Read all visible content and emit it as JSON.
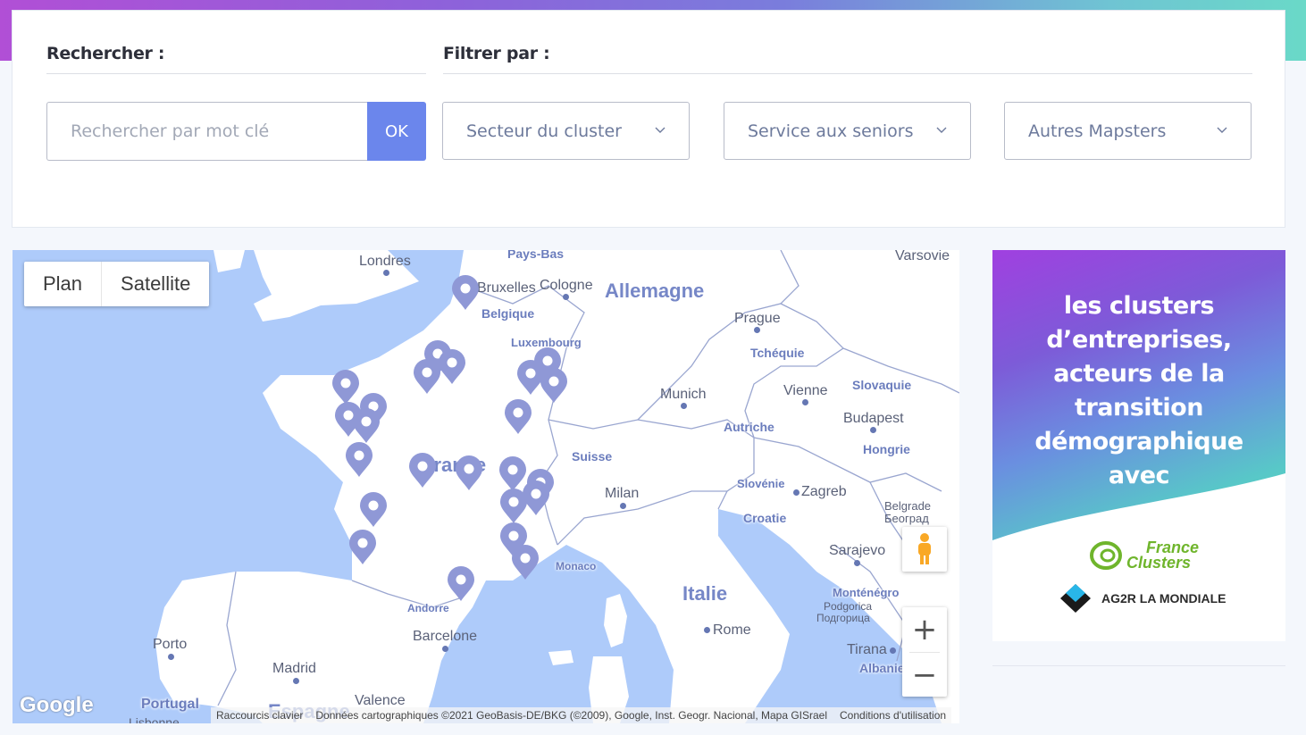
{
  "search": {
    "title": "Rechercher :",
    "placeholder": "Rechercher par mot clé",
    "ok_label": "OK"
  },
  "filters": {
    "title": "Filtrer par :",
    "selects": [
      {
        "label": "Secteur du cluster"
      },
      {
        "label": "Service aux seniors"
      },
      {
        "label": "Autres Mapsters"
      }
    ]
  },
  "map": {
    "maptype": {
      "plan": "Plan",
      "satellite": "Satellite"
    },
    "zoom_in": "+",
    "zoom_out": "−",
    "logo": "Google",
    "attribution": {
      "shortcuts": "Raccourcis clavier",
      "data": "Données cartographiques ©2021 GeoBasis-DE/BKG (©2009), Google, Inst. Geogr. Nacional, Mapa GISrael",
      "terms": "Conditions d'utilisation"
    },
    "labels": {
      "londres": "Londres",
      "paysbas": "Pays-Bas",
      "bruxelles": "Bruxelles",
      "cologne": "Cologne",
      "belgique": "Belgique",
      "allemagne": "Allemagne",
      "varsovie": "Varsovie",
      "prague": "Prague",
      "tcheque": "Tchéquie",
      "luxembourg": "Luxembourg",
      "munich": "Munich",
      "vienne": "Vienne",
      "slovaquie": "Slovaquie",
      "budapest": "Budapest",
      "autriche": "Autriche",
      "hongrie": "Hongrie",
      "france": "France",
      "suisse": "Suisse",
      "slovenie": "Slovénie",
      "zagreb": "Zagreb",
      "milan": "Milan",
      "croatie": "Croatie",
      "belgrade": "Belgrade",
      "beograd": "Београд",
      "sarajevo": "Sarajevo",
      "monaco": "Monaco",
      "italie": "Italie",
      "montenegro": "Monténégro",
      "podgorica": "Podgorica",
      "podgorica_cyr": "Подгорица",
      "andorre": "Andorre",
      "barcelone": "Barcelone",
      "rome": "Rome",
      "tirana": "Tirana",
      "albanie": "Albanie",
      "porto": "Porto",
      "madrid": "Madrid",
      "portugal": "Portugal",
      "valence": "Valence",
      "espagne": "Espagne",
      "lisbonne": "Lisbonne"
    },
    "marker_count": 24,
    "marker_color": "#8f98d6"
  },
  "ad": {
    "headline_lines": [
      "les clusters",
      "d’entreprises,",
      "acteurs de la",
      "transition",
      "démographique",
      "avec"
    ],
    "logo1_line1": "France",
    "logo1_line2": "Clusters",
    "logo2": "AG2R LA MONDIALE"
  },
  "colors": {
    "accent": "#6b86ec",
    "map_water": "#aecbfa",
    "map_land": "#ffffff"
  }
}
